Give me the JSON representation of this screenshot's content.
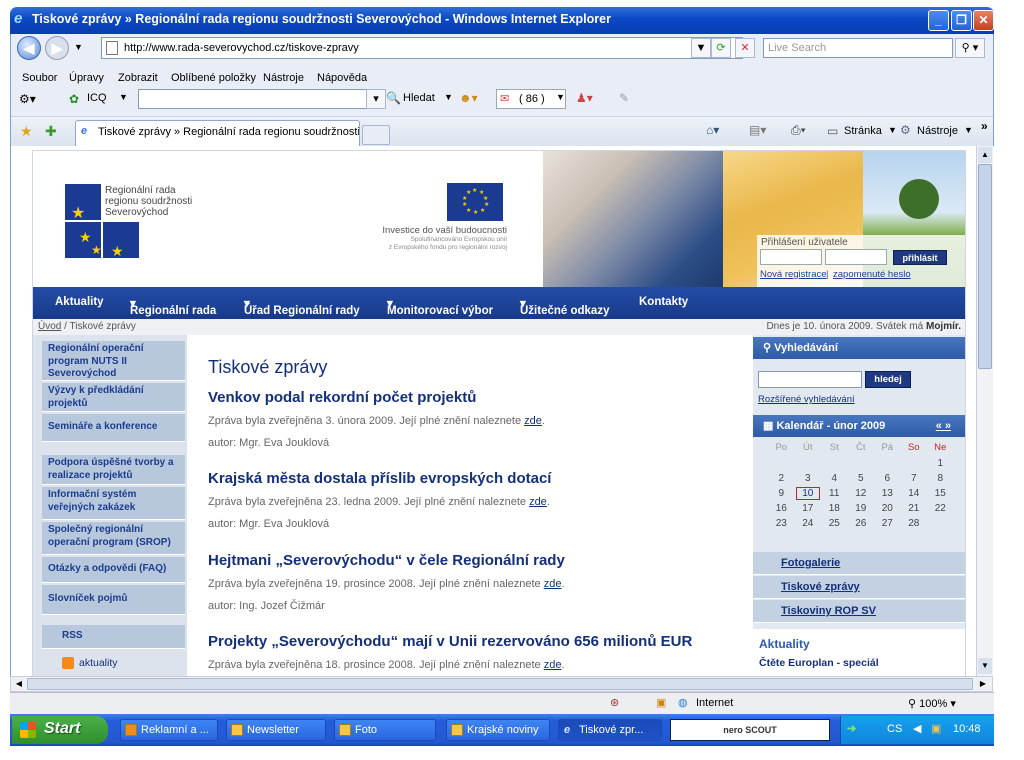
{
  "window": {
    "title": "Tiskové zprávy » Regionální rada regionu soudržnosti Severovýchod - Windows Internet Explorer"
  },
  "address": {
    "url": "http://www.rada-severovychod.cz/tiskove-zpravy",
    "search_placeholder": "Live Search"
  },
  "menu": [
    "Soubor",
    "Úpravy",
    "Zobrazit",
    "Oblíbené položky",
    "Nástroje",
    "Nápověda"
  ],
  "toolbar": {
    "icq": "ICQ",
    "find": "Hledat",
    "mail_count": "( 86 )",
    "page": "Stránka",
    "tools": "Nástroje"
  },
  "tab": {
    "title": "Tiskové zprávy » Regionální rada regionu soudržnosti ..."
  },
  "site": {
    "logo_lines": [
      "Regionální rada",
      "regionu soudržnosti",
      "Severovýchod"
    ],
    "eu_slogan": "Investice do vaší budoucnosti",
    "eu_sub": [
      "Spolufinancováno Evropskou unií",
      "z Evropského fondu pro regionální rozvoj"
    ],
    "login": {
      "label": "Přihlášení uživatele",
      "button": "přihlásit",
      "register": "Nová registrace",
      "forgot": "zapomenuté heslo"
    },
    "nav": [
      "Aktuality",
      "Regionální rada",
      "Úřad Regionální rady",
      "Monitorovací výbor",
      "Užitečné odkazy",
      "Kontakty"
    ],
    "breadcrumb": {
      "home": "Úvod",
      "current": "Tiskové zprávy"
    },
    "date_text": "Dnes je 10. února 2009. Svátek má",
    "name_day": "Mojmír.",
    "left_menu": [
      "Regionální operační program NUTS II Severovýchod",
      "Výzvy k předkládání projektů",
      "Semináře a konference",
      "Podpora úspěšné tvorby a realizace projektů",
      "Informační systém veřejných zakázek",
      "Společný regionální operační program (SROP)",
      "Otázky a odpovědi (FAQ)",
      "Slovníček pojmů"
    ],
    "rss": {
      "title": "RSS",
      "item": "aktuality"
    },
    "main_title": "Tiskové zprávy",
    "articles": [
      {
        "title": "Venkov podal rekordní počet projektů",
        "published": "Zpráva byla zveřejněna 3. února 2009. Její plné znění naleznete",
        "link": "zde",
        "author": "autor: Mgr. Eva Jouklová"
      },
      {
        "title": "Krajská města dostala příslib evropských dotací",
        "published": "Zpráva byla zveřejněna 23. ledna 2009. Její plné znění naleznete",
        "link": "zde",
        "author": "autor: Mgr. Eva Jouklová"
      },
      {
        "title": "Hejtmani „Severovýchodu“ v čele Regionální rady",
        "published": "Zpráva byla zveřejněna 19. prosince 2008. Její plné znění naleznete",
        "link": "zde",
        "author": "autor: Ing. Jozef Čižmár"
      },
      {
        "title": "Projekty „Severovýchodu“ mají v Unii rezervováno 656 milionů EUR",
        "published": "Zpráva byla zveřejněna 18. prosince 2008. Její plné znění naleznete",
        "link": "zde",
        "author": ""
      }
    ],
    "search": {
      "title": "Vyhledávání",
      "button": "hledej",
      "advanced": "Rozšířené vyhledávání"
    },
    "calendar": {
      "title": "Kalendář - únor 2009",
      "nav": "« »",
      "days": [
        "Po",
        "Út",
        "St",
        "Čt",
        "Pá",
        "So",
        "Ne"
      ],
      "weeks": [
        [
          "",
          "",
          "",
          "",
          "",
          "",
          "1"
        ],
        [
          "2",
          "3",
          "4",
          "5",
          "6",
          "7",
          "8"
        ],
        [
          "9",
          "10",
          "11",
          "12",
          "13",
          "14",
          "15"
        ],
        [
          "16",
          "17",
          "18",
          "19",
          "20",
          "21",
          "22"
        ],
        [
          "23",
          "24",
          "25",
          "26",
          "27",
          "28",
          ""
        ]
      ],
      "today": "10"
    },
    "right_links": [
      "Fotogalerie",
      "Tiskové zprávy",
      "Tiskoviny ROP SV"
    ],
    "news": {
      "title": "Aktuality",
      "item": "Čtěte Europlan - speciál"
    }
  },
  "status": {
    "zone": "Internet",
    "zoom": "100%"
  },
  "taskbar": {
    "start": "Start",
    "tasks": [
      "Reklamní a ...",
      "Newsletter",
      "Foto",
      "Krajské noviny",
      "Tiskové zpr..."
    ],
    "search_logo": "nero SCOUT",
    "lang": "CS",
    "clock": "10:48"
  },
  "colors": {
    "title_blue": "#0a48c4",
    "site_blue": "#1f3f95",
    "link_blue": "#14307a",
    "weekend_red": "#c0262d"
  }
}
